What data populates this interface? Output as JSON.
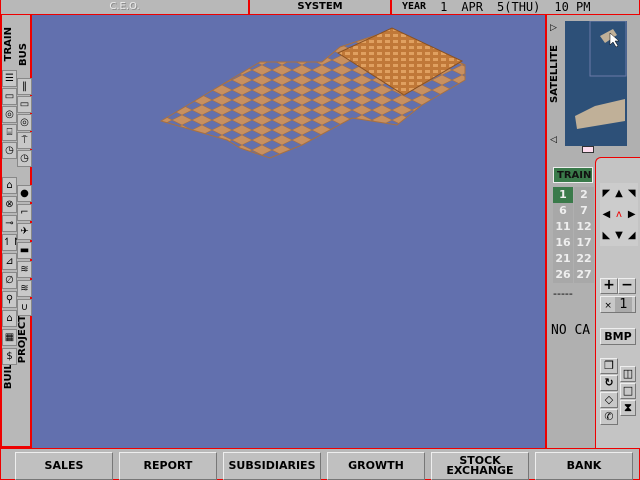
{
  "top": {
    "ceo": "C.E.O.",
    "system": "SYSTEM",
    "year_label": "YEAR",
    "year": "1",
    "month": "APR",
    "day": "5",
    "weekday": "(THU)",
    "time": "10 PM"
  },
  "left": {
    "train": "TRAIN",
    "bus": "BUS",
    "build": "BUILD",
    "project": "PROJECT",
    "train_tools": [
      "☰",
      "▭",
      "◎",
      "⌸",
      "◷"
    ],
    "bus_tools": [
      "‖",
      "▭",
      "◎",
      "⍑",
      "◷"
    ],
    "build_tools": [
      "⌂",
      "⊗",
      "⊸",
      "↿↾",
      "⊿",
      "∅",
      "⚲",
      "⌂",
      "▦",
      "$"
    ],
    "project_tools": [
      "●",
      "⌐",
      "✈",
      "▬",
      "≋",
      "≋",
      "∪"
    ]
  },
  "right": {
    "satellite": "SATELLITE",
    "tab": "TRAIN",
    "days": [
      "1",
      "2",
      "6",
      "7",
      "11",
      "12",
      "16",
      "17",
      "21",
      "22",
      "26",
      "27"
    ],
    "dashes": "-----",
    "no_car": "NO CA",
    "zoom_plus": "+",
    "zoom_minus": "−",
    "scale_x": "×",
    "scale_val": "1",
    "bmp": "BMP"
  },
  "bottom": {
    "buttons": [
      "SALES",
      "REPORT",
      "SUBSIDIARIES",
      "GROWTH",
      "STOCK EXCHANGE",
      "BANK"
    ]
  },
  "colors": {
    "sea": "#6270ae",
    "land": "#c89060",
    "frame": "#ee0000",
    "panel": "#b8b8b8"
  }
}
